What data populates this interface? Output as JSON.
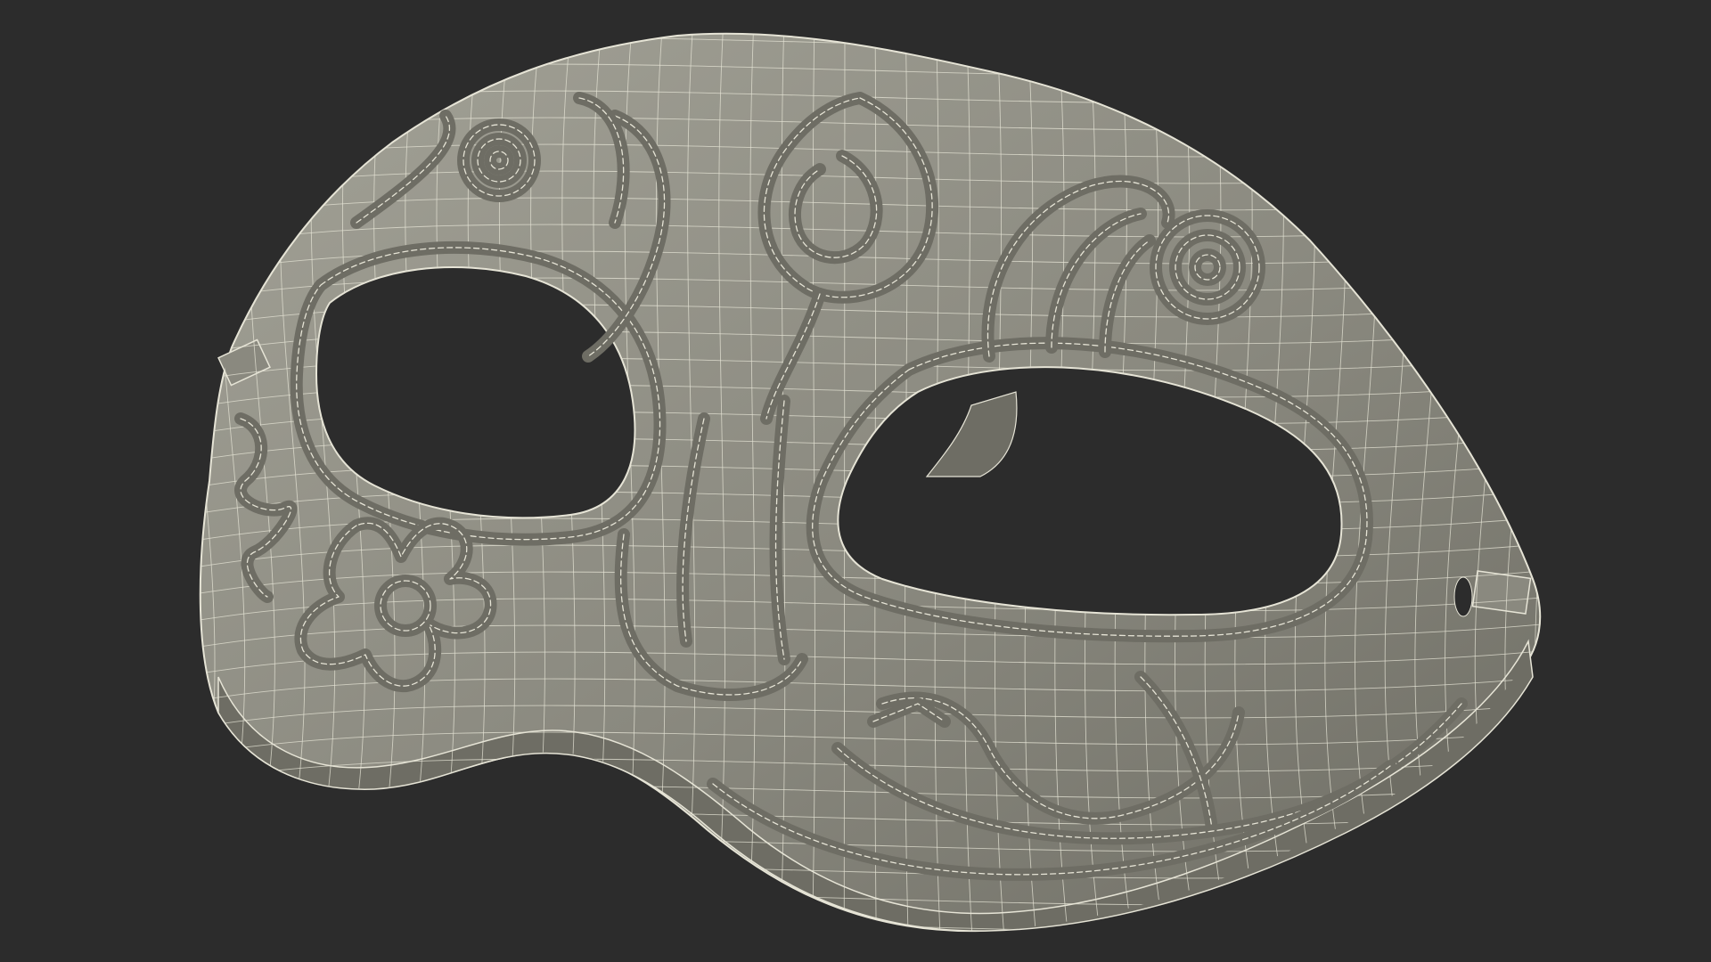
{
  "scene": {
    "subject": "mask-3d-wireframe",
    "background_color": "#2c2c2c",
    "mesh_fill_color": "#8a897f",
    "mesh_shade_color": "#6e6d64",
    "mesh_highlight_color": "#a3a297",
    "wire_color": "#e6e4d6",
    "eye_hole_color": "#2c2c2c"
  }
}
